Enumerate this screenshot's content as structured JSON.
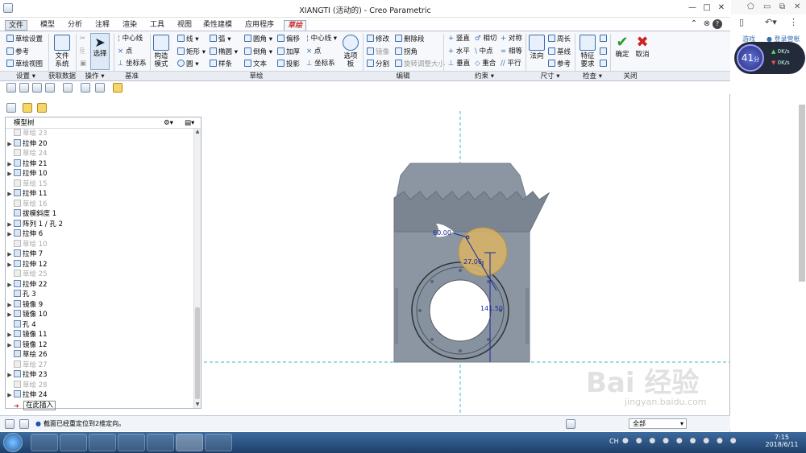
{
  "window": {
    "title": "XIANGTI (活动的) - Creo Parametric",
    "minimize_glyph": "—",
    "restore_glyph": "□",
    "close_glyph": "✕",
    "help_glyph": "?"
  },
  "menu": {
    "tabs": [
      "文件",
      "模型",
      "分析",
      "注释",
      "渲染",
      "工具",
      "视图",
      "柔性建模",
      "应用程序",
      "草绘"
    ],
    "active_tab": "草绘"
  },
  "ribbon": {
    "settings": {
      "items": [
        "草绘设置",
        "参考",
        "草绘视图"
      ]
    },
    "data": {
      "file_system": "文件\n系统"
    },
    "operations": {
      "select": "选择"
    },
    "datum": {
      "items": [
        "中心线",
        "点",
        "坐标系"
      ]
    },
    "sketch": {
      "construction": "构造\n模式",
      "items": [
        "线",
        "弧",
        "圆角",
        "偏移",
        "中心线",
        "矩形",
        "椭圆",
        "倒角",
        "加厚",
        "点",
        "圆",
        "样条",
        "文本",
        "投影",
        "坐标系"
      ],
      "palette": "选项\n板"
    },
    "edit": {
      "items": [
        "修改",
        "删除段",
        "镜像",
        "拐角",
        "分割",
        "旋转调整大小"
      ]
    },
    "constrain": {
      "items": [
        "竖直",
        "相切",
        "对称",
        "水平",
        "中点",
        "相等",
        "垂直",
        "重合",
        "平行"
      ]
    },
    "dimension": {
      "normal": "法向",
      "items": [
        "周长",
        "基线",
        "参考"
      ]
    },
    "inspect": {
      "feature_req": "特征\n要求"
    },
    "close": {
      "ok": "确定",
      "cancel": "取消"
    },
    "groups": [
      "设置",
      "获取数据",
      "操作",
      "基准",
      "草绘",
      "编辑",
      "约束",
      "尺寸",
      "检查",
      "关闭"
    ]
  },
  "model_tree": {
    "header": "模型树",
    "rows": [
      {
        "label": "草绘 23",
        "grey": true,
        "arrow": false
      },
      {
        "label": "拉伸 20",
        "grey": false,
        "arrow": true
      },
      {
        "label": "草绘 24",
        "grey": true,
        "arrow": false
      },
      {
        "label": "拉伸 21",
        "grey": false,
        "arrow": true
      },
      {
        "label": "拉伸 10",
        "grey": false,
        "arrow": true
      },
      {
        "label": "草绘 15",
        "grey": true,
        "arrow": false
      },
      {
        "label": "拉伸 11",
        "grey": false,
        "arrow": true
      },
      {
        "label": "草绘 16",
        "grey": true,
        "arrow": false
      },
      {
        "label": "拔模斜度 1",
        "grey": false,
        "arrow": false
      },
      {
        "label": "阵列 1 / 孔 2",
        "grey": false,
        "arrow": true
      },
      {
        "label": "拉伸 6",
        "grey": false,
        "arrow": true
      },
      {
        "label": "草绘 10",
        "grey": true,
        "arrow": false
      },
      {
        "label": "拉伸 7",
        "grey": false,
        "arrow": true
      },
      {
        "label": "拉伸 12",
        "grey": false,
        "arrow": true
      },
      {
        "label": "草绘 25",
        "grey": true,
        "arrow": false
      },
      {
        "label": "拉伸 22",
        "grey": false,
        "arrow": true
      },
      {
        "label": "孔 3",
        "grey": false,
        "arrow": false
      },
      {
        "label": "镜像 9",
        "grey": false,
        "arrow": true
      },
      {
        "label": "镜像 10",
        "grey": false,
        "arrow": true
      },
      {
        "label": "孔 4",
        "grey": false,
        "arrow": false
      },
      {
        "label": "镜像 11",
        "grey": false,
        "arrow": true
      },
      {
        "label": "镜像 12",
        "grey": false,
        "arrow": true
      },
      {
        "label": "草绘 26",
        "grey": false,
        "arrow": false
      },
      {
        "label": "草绘 27",
        "grey": true,
        "arrow": false
      },
      {
        "label": "拉伸 23",
        "grey": false,
        "arrow": true
      },
      {
        "label": "草绘 28",
        "grey": true,
        "arrow": false
      },
      {
        "label": "拉伸 24",
        "grey": false,
        "arrow": true
      },
      {
        "label": "在此插入",
        "grey": false,
        "arrow": false
      }
    ]
  },
  "dimensions": {
    "d1": "60.00",
    "d2": "27.06",
    "d3": "141.50"
  },
  "status_bar": {
    "message": "截面已经重定位到2维定向。",
    "filter": "全部"
  },
  "right_panel": {
    "links": [
      "游戏",
      "登录营帐"
    ],
    "speed_value": "41",
    "speed_unit": "分",
    "up": "0K/s",
    "down": "0K/s"
  },
  "taskbar": {
    "time": "7:15",
    "date": "2018/6/11",
    "lang": "CH"
  },
  "watermark": {
    "brand": "Bai 经验",
    "url": "jingyan.baidu.com"
  },
  "colors": {
    "part": "#8c96a3",
    "part_dark": "#6f7a87",
    "dimension": "#1a2a9c",
    "circle_fill": "#d9b465",
    "centerline": "#3fb8c8",
    "titlebar_accent": "#c33"
  }
}
